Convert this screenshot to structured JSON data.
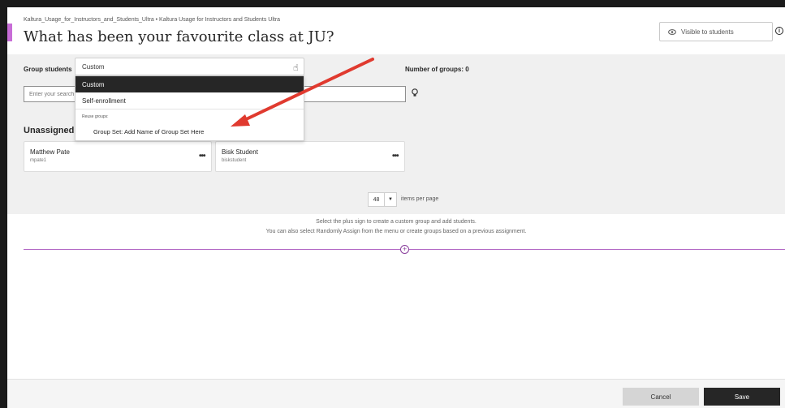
{
  "header": {
    "breadcrumb": "Kaltura_Usage_for_Instructors_and_Students_Ultra • Kaltura Usage for Instructors and Students Ultra",
    "title": "What has been your favourite class at JU?",
    "visibility_label": "Visible to students"
  },
  "grouping": {
    "label": "Group students",
    "selected": "Custom",
    "number_of_groups": "Number of groups: 0",
    "search_placeholder": "Enter your search"
  },
  "dropdown": {
    "options": [
      "Custom",
      "Self-enrollment"
    ],
    "reuse_heading": "Reuse groups:",
    "group_set": "Group Set: Add Name of Group Set Here"
  },
  "unassigned": {
    "heading": "Unassigned st",
    "students": [
      {
        "name": "Matthew Pate",
        "id": "mpate1"
      },
      {
        "name": "Bisk Student",
        "id": "biskstudent"
      }
    ]
  },
  "pagination": {
    "per_page_value": "48",
    "label": "items per page"
  },
  "help": {
    "line1": "Select the plus sign to create a custom group and add students.",
    "line2": "You can also select Randomly Assign from the menu or create groups based on a previous assignment."
  },
  "footer": {
    "cancel": "Cancel",
    "save": "Save"
  },
  "colors": {
    "accent": "#c86dd7",
    "annotation_arrow": "#e03a2f",
    "primary_button": "#262626"
  }
}
